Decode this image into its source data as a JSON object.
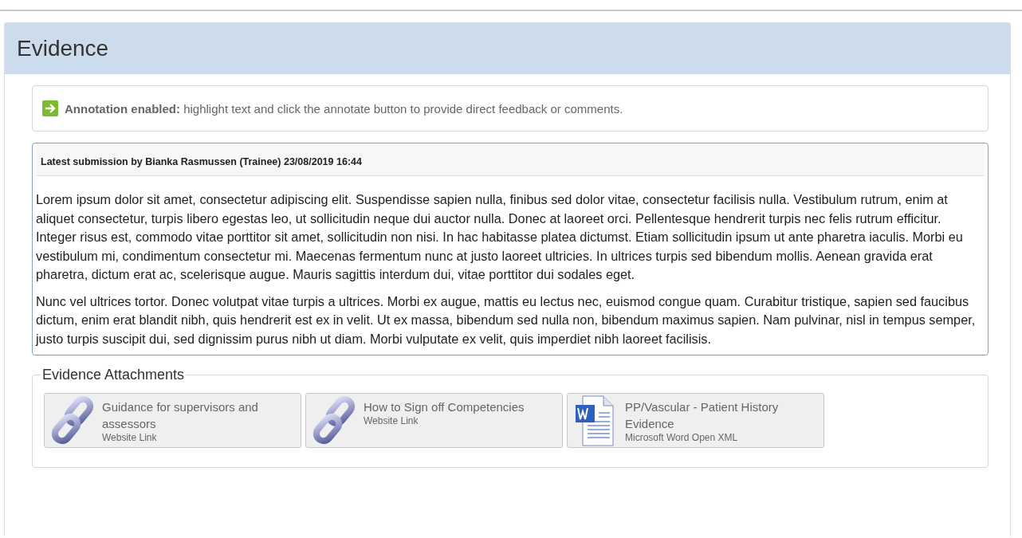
{
  "panel": {
    "title": "Evidence"
  },
  "notice": {
    "text": "**Annotation enabled:** highlight text and click the annotate button to provide direct feedback or comments."
  },
  "submission": {
    "heading": "Latest submission by Bianka Rasmussen (Trainee) 23/08/2019 16:44",
    "paragraphs": [
      "Lorem ipsum dolor sit amet, consectetur adipiscing elit. Suspendisse sapien nulla, finibus sed dolor vitae, consectetur facilisis nulla. Vestibulum rutrum, enim at aliquet consectetur, turpis libero egestas leo, ut sollicitudin neque dui auctor nulla. Donec at laoreet orci. Pellentesque hendrerit turpis nec felis rutrum efficitur. Integer risus est, commodo vitae porttitor sit amet, sollicitudin non nisi. In hac habitasse platea dictumst. Etiam sollicitudin ipsum ut ante pharetra iaculis. Morbi eu vestibulum mi, condimentum consectetur mi. Maecenas fermentum nunc at justo laoreet ultricies. In ultrices turpis sed bibendum mollis. Aenean gravida erat pharetra, dictum erat ac, scelerisque augue. Mauris sagittis interdum dui, vitae porttitor dui sodales eget.",
      "Nunc vel ultrices tortor. Donec volutpat vitae turpis a ultrices. Morbi ex augue, mattis eu lectus nec, euismod congue quam. Curabitur tristique, sapien sed faucibus dictum, enim erat blandit nibh, quis hendrerit est ex in velit. Ut ex massa, bibendum sed nulla non, bibendum maximus sapien. Nam pulvinar, nisl in tempus semper, justo turpis suscipit dui, sed dignissim purus nibh ut diam. Morbi vulputate ex velit, quis imperdiet nibh laoreet facilisis."
    ]
  },
  "attachments": {
    "legend": "Evidence Attachments",
    "items": [
      {
        "kind": "link",
        "title": "Guidance for supervisors and assessors",
        "type": "Website Link"
      },
      {
        "kind": "link",
        "title": "How to Sign off Competencies",
        "type": "Website Link"
      },
      {
        "kind": "document",
        "title": "PP/Vascular - Patient History Evidence",
        "type": "Microsoft Word Open XML"
      }
    ]
  }
}
